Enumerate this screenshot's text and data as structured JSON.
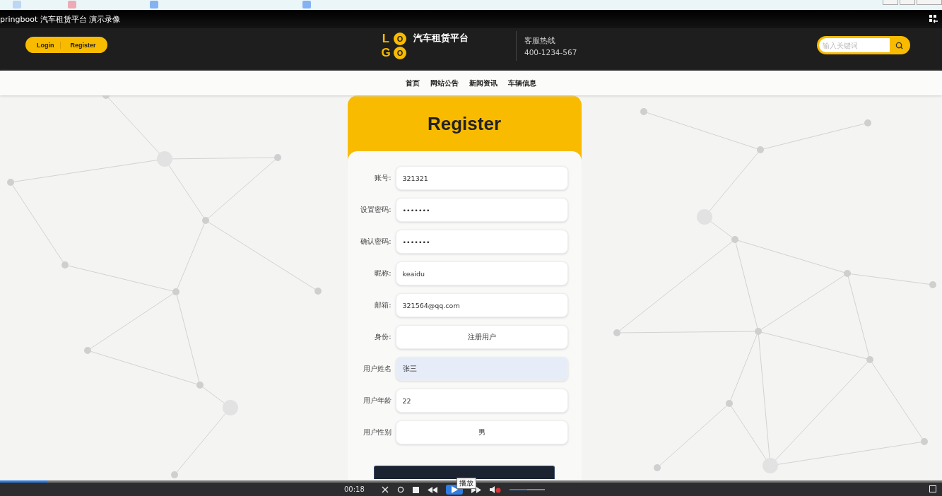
{
  "video_title": "pringboot 汽车租赁平台 演示录像",
  "header": {
    "auth_buttons": [
      "Login",
      "Register"
    ],
    "logo_letters": [
      "L",
      "O",
      "G",
      "O"
    ],
    "site_name": "汽车租赁平台",
    "hotline_label": "客服热线",
    "hotline_number": "400-1234-567",
    "search": {
      "placeholder": "输入关键词"
    }
  },
  "nav": [
    "首页",
    "网站公告",
    "新闻资讯",
    "车辆信息"
  ],
  "form": {
    "title": "Register",
    "fields": [
      {
        "label": "账号:",
        "value": "321321",
        "kind": "text",
        "highlighted": false
      },
      {
        "label": "设置密码:",
        "value": "•••••••",
        "kind": "text",
        "highlighted": false
      },
      {
        "label": "确认密码:",
        "value": "•••••••",
        "kind": "text",
        "highlighted": false
      },
      {
        "label": "昵称:",
        "value": "keaidu",
        "kind": "text",
        "highlighted": false
      },
      {
        "label": "邮箱:",
        "value": "321564@qq.com",
        "kind": "text",
        "highlighted": false
      },
      {
        "label": "身份:",
        "value": "注册用户",
        "kind": "select",
        "highlighted": false
      },
      {
        "label": "用户姓名",
        "value": "张三",
        "kind": "text",
        "highlighted": true
      },
      {
        "label": "用户年龄",
        "value": "22",
        "kind": "text",
        "highlighted": false
      },
      {
        "label": "用户性别",
        "value": "男",
        "kind": "select",
        "highlighted": false
      }
    ]
  },
  "player": {
    "time": "00:18",
    "tooltip": "播放",
    "progress": {
      "level": 0.05
    },
    "volume": {
      "level": 0.5
    }
  }
}
